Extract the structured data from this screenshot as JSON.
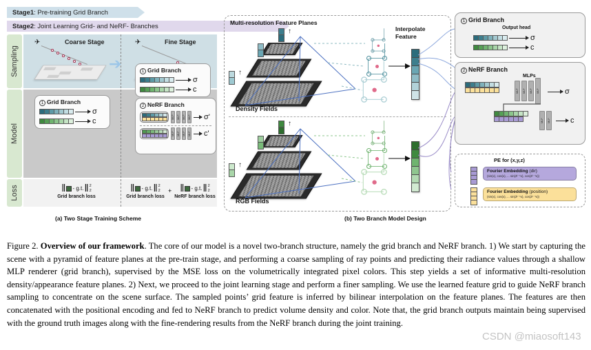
{
  "stages": {
    "stage1": {
      "label": "Stage1",
      "text": ": Pre-training Grid Branch",
      "color": "#cfe0ea"
    },
    "stage2": {
      "label": "Stage2",
      "text": ": Joint Learning Grid- and NeRF- Branches",
      "color": "#e0d8ec"
    }
  },
  "panel_a": {
    "row_labels": {
      "sampling": "Sampling",
      "model": "Model",
      "loss": "Loss"
    },
    "coarse_stage_title": "Coarse Stage",
    "fine_stage_title": "Fine Stage",
    "grid_branch_title": "Grid Branch",
    "nerf_branch_title": "NeRF Branch",
    "num_one": "1",
    "num_two": "2",
    "sigma": "σ",
    "color_c": "c",
    "sigma_prime": "σ'",
    "color_c_prime": "c'",
    "mlp_tag": "MLP",
    "loss_left": {
      "gt": "- g.t.",
      "sup": "2",
      "sub": "2",
      "caption": "Grid branch loss"
    },
    "loss_right_a": {
      "gt": "- g.t.",
      "sup": "2",
      "sub": "2",
      "caption": "Grid branch loss"
    },
    "loss_right_b": {
      "gt": "- g.t.",
      "sup": "2",
      "sub": "2",
      "caption": "NeRF branch loss"
    },
    "plus": "+",
    "subcaption": "(a) Two Stage Training Scheme"
  },
  "panel_b": {
    "planes_title": "Multi-resolution Feature Planes",
    "density_label": "Density Fields",
    "rgb_label": "RGB Fields",
    "interpolate_line1": "Interpolate",
    "interpolate_line2": "Feature",
    "subcaption": "(b) Two Branch Model Design",
    "density_color": "#2f6e7d",
    "rgb_color": "#4f9a4f"
  },
  "panel_c": {
    "grid_branch_title": "Grid Branch",
    "nerf_branch_title": "NeRF Branch",
    "num_one": "1",
    "num_two": "2",
    "output_head": "Output head",
    "mlps": "MLPs",
    "mlp_tag": "MLP",
    "sigma": "σ",
    "color_c": "c",
    "pe_title": "PE for (x,y,z)",
    "fourier_dir": {
      "title": "Fourier Embedding",
      "suffix": " (dir)",
      "formula": "(sin(x), cos(x), ... sin(2ᴸ⁻¹x), cos(2ᴸ⁻¹x))",
      "color": "#b5a8dd"
    },
    "fourier_pos": {
      "title": "Fourier Embedding",
      "suffix": " (position)",
      "formula": "(sin(x), cos(x), ... sin(2ᴸ⁻¹x), cos(2ᴸ⁻¹x))",
      "color": "#fbe09a"
    }
  },
  "caption": {
    "figure_number": "Figure 2. ",
    "bold_title": "Overview of our framework",
    "body": ". The core of our model is a novel two-branch structure, namely the grid branch and NeRF branch. 1) We start by capturing the scene with a pyramid of feature planes at the pre-train stage, and performing a coarse sampling of ray points and predicting their radiance values through a shallow MLP renderer (grid branch), supervised by the MSE loss on the volumetrically integrated pixel colors. This step yields a set of informative multi-resolution density/appearance feature planes. 2) Next, we proceed to the joint learning stage and perform a finer sampling. We use the learned feature grid to guide NeRF branch sampling to concentrate on the scene surface. The sampled points’ grid feature is inferred by bilinear interpolation on the feature planes. The features are then concatenated with the positional encoding and fed to NeRF branch to predict volume density and color. Note that, the grid branch outputs maintain being supervised with the ground truth images along with the fine-rendering results from the NeRF branch during the joint training."
  },
  "watermark": "CSDN @miaosoft143"
}
